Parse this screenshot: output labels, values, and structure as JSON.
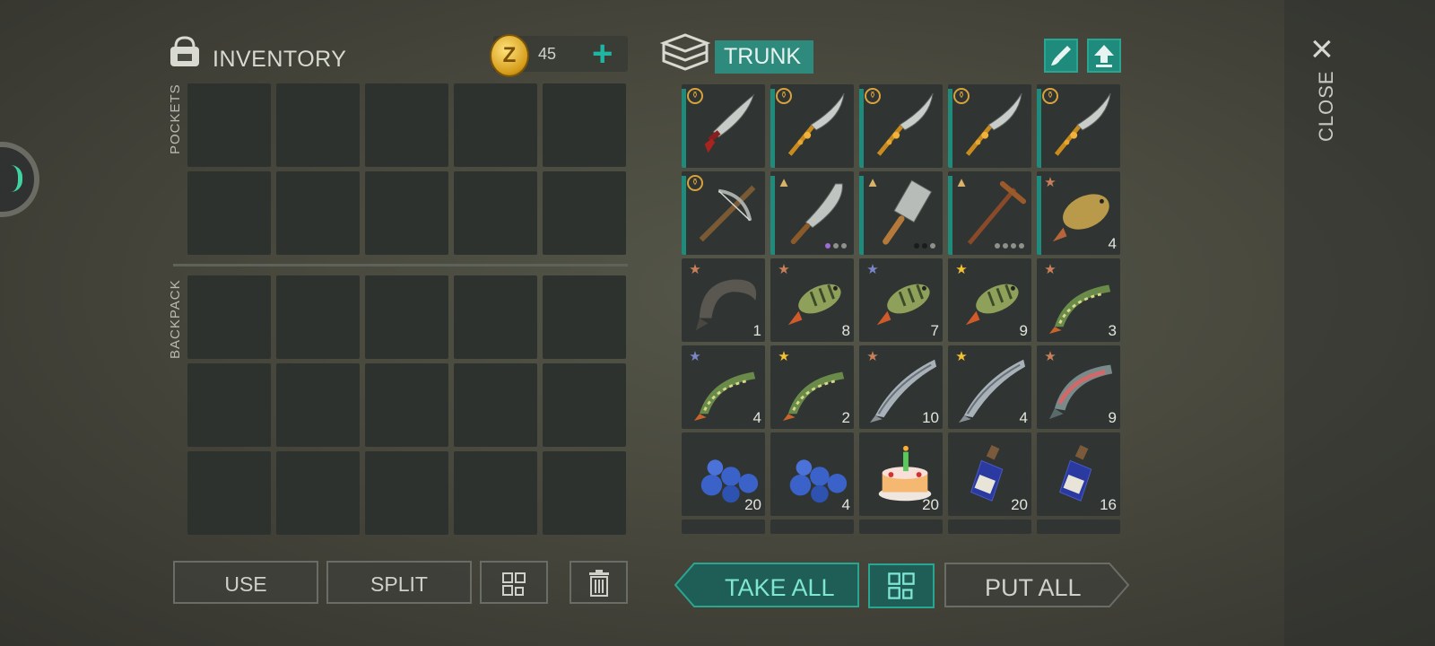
{
  "inventory": {
    "title": "INVENTORY",
    "coins": "45",
    "coin_symbol": "Z",
    "add_label": "+",
    "pockets_label": "POCKETS",
    "backpack_label": "BACKPACK"
  },
  "trunk": {
    "title": "TRUNK",
    "close_label": "CLOSE",
    "close_icon": "×",
    "items": [
      {
        "kind": "dagger",
        "badge": "pan",
        "count": ""
      },
      {
        "kind": "gold-sword",
        "badge": "pan",
        "count": ""
      },
      {
        "kind": "gold-sword",
        "badge": "pan",
        "count": ""
      },
      {
        "kind": "gold-sword",
        "badge": "pan",
        "count": ""
      },
      {
        "kind": "gold-sword",
        "badge": "pan",
        "count": ""
      },
      {
        "kind": "crossbow",
        "badge": "pan",
        "count": ""
      },
      {
        "kind": "machete",
        "badge": "tri",
        "count": ""
      },
      {
        "kind": "cleaver",
        "badge": "tri",
        "count": ""
      },
      {
        "kind": "pickaxe",
        "badge": "tri",
        "count": ""
      },
      {
        "kind": "carp",
        "badge": "star-bronze",
        "count": "4"
      },
      {
        "kind": "catfish",
        "badge": "star-bronze",
        "count": "1"
      },
      {
        "kind": "perch",
        "badge": "star-bronze",
        "count": "8"
      },
      {
        "kind": "perch",
        "badge": "star-blue",
        "count": "7"
      },
      {
        "kind": "perch",
        "badge": "star-gold",
        "count": "9"
      },
      {
        "kind": "pike",
        "badge": "star-bronze",
        "count": "3"
      },
      {
        "kind": "pike",
        "badge": "star-blue",
        "count": "4"
      },
      {
        "kind": "pike",
        "badge": "star-gold",
        "count": "2"
      },
      {
        "kind": "salmon",
        "badge": "star-bronze",
        "count": "10"
      },
      {
        "kind": "salmon",
        "badge": "star-gold",
        "count": "4"
      },
      {
        "kind": "trout",
        "badge": "star-bronze",
        "count": "9"
      },
      {
        "kind": "blueberries",
        "badge": "",
        "count": "20"
      },
      {
        "kind": "blueberries",
        "badge": "",
        "count": "4"
      },
      {
        "kind": "cake",
        "badge": "",
        "count": "20"
      },
      {
        "kind": "bottle",
        "badge": "",
        "count": "20"
      },
      {
        "kind": "bottle",
        "badge": "",
        "count": "16"
      }
    ]
  },
  "buttons": {
    "use": "USE",
    "split": "SPLIT",
    "take_all": "TAKE ALL",
    "put_all": "PUT ALL"
  },
  "colors": {
    "accent": "#1f8b7c",
    "accent_text": "#7fe6d3",
    "slot": "#2e322f",
    "star_gold": "#f2c230",
    "star_bronze": "#c9805a",
    "star_blue": "#7a86c8"
  }
}
